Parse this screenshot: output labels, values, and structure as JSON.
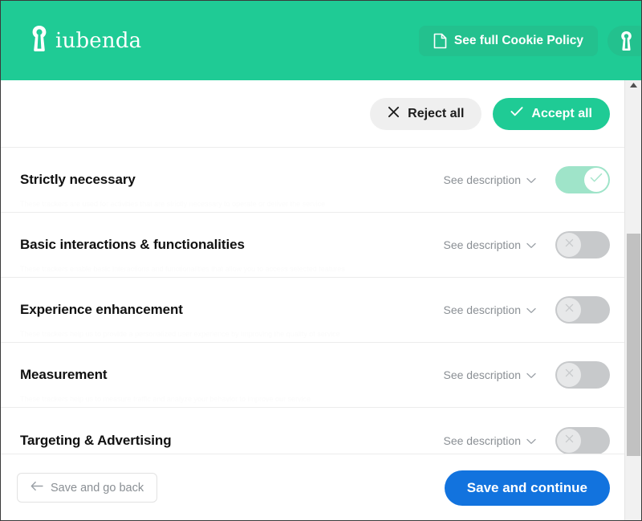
{
  "header": {
    "brand_name": "iubenda",
    "brand_icon": "keyhole-icon",
    "cookie_policy_button": {
      "label": "See full Cookie Policy",
      "icon": "document-icon"
    },
    "secondary_button": {
      "label": "",
      "icon": "keyhole-icon"
    }
  },
  "topbar": {
    "reject_all": {
      "label": "Reject all",
      "icon": "close-x-icon"
    },
    "accept_all": {
      "label": "Accept all",
      "icon": "check-icon"
    }
  },
  "categories": [
    {
      "title": "Strictly necessary",
      "see_description": "See description",
      "toggle_state": "on",
      "toggle_icon": "check-icon"
    },
    {
      "title": "Basic interactions & functionalities",
      "see_description": "See description",
      "toggle_state": "off",
      "toggle_icon": "close-x-icon"
    },
    {
      "title": "Experience enhancement",
      "see_description": "See description",
      "toggle_state": "off",
      "toggle_icon": "close-x-icon"
    },
    {
      "title": "Measurement",
      "see_description": "See description",
      "toggle_state": "off",
      "toggle_icon": "close-x-icon"
    },
    {
      "title": "Targeting & Advertising",
      "see_description": "See description",
      "toggle_state": "off",
      "toggle_icon": "close-x-icon"
    }
  ],
  "footer": {
    "back_button": {
      "label": "Save and go back",
      "icon": "arrow-left-icon"
    },
    "continue_button": {
      "label": "Save and continue"
    }
  },
  "colors": {
    "brand_green": "#1fcb95",
    "toggle_on_track": "#9fe4c9",
    "toggle_off_track": "#c7c9cb",
    "primary_blue": "#1273de",
    "reject_gray": "#efefef"
  }
}
